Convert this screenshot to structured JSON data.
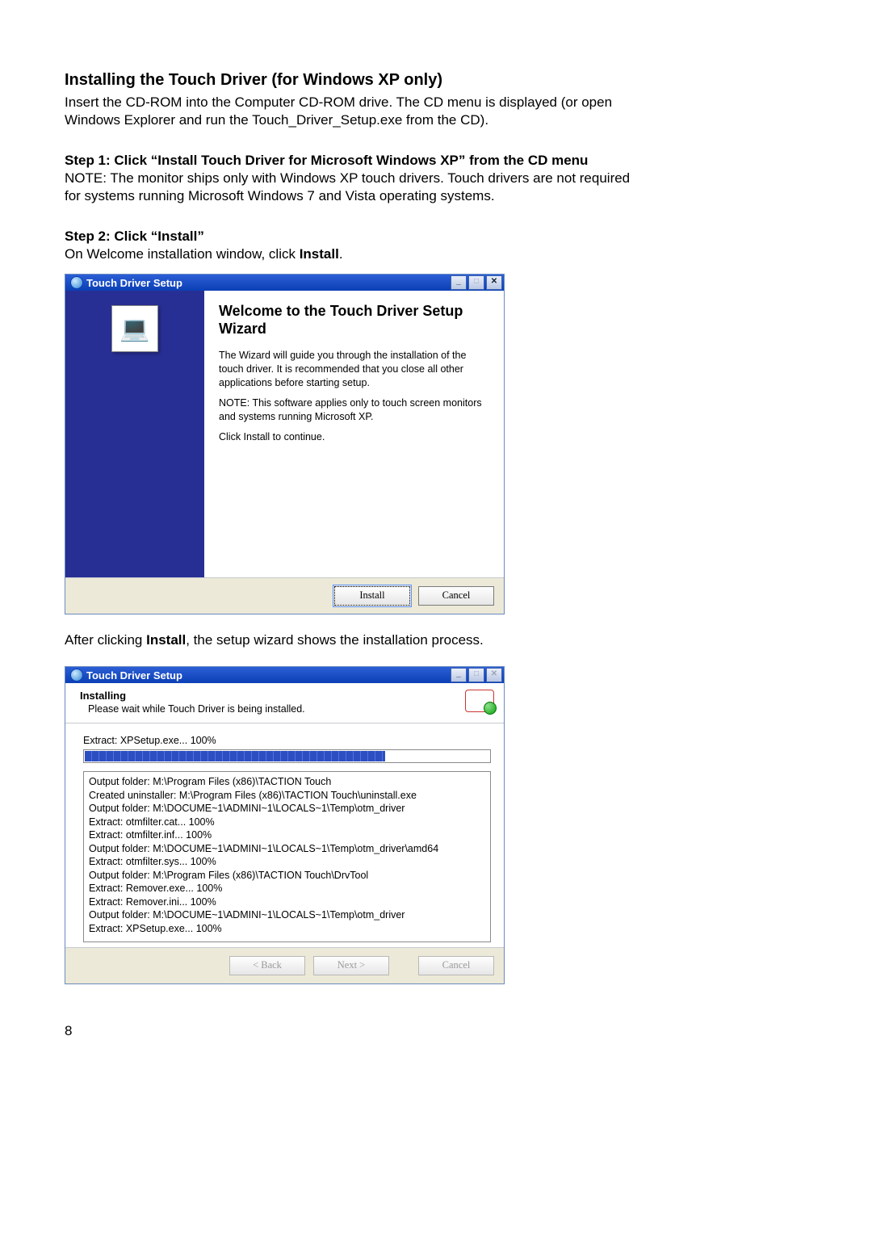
{
  "heading": "Installing the Touch Driver (for Windows XP only)",
  "intro_line1": "Insert the CD-ROM into the Computer CD-ROM drive. The CD menu is displayed (or open",
  "intro_line2": "Windows Explorer and run the Touch_Driver_Setup.exe from the CD).",
  "step1_title": "Step 1: Click “Install Touch Driver for Microsoft Windows XP” from the CD menu",
  "step1_note1": "NOTE: The monitor ships only with Windows XP touch drivers.  Touch drivers are not required",
  "step1_note2": "for systems running Microsoft Windows 7 and Vista operating systems.",
  "step2_title": "Step 2: Click “Install”",
  "step2_text_a": "On Welcome installation window, click ",
  "step2_text_b": "Install",
  "step2_text_c": ".",
  "after_a": "After clicking ",
  "after_b": "Install",
  "after_c": ", the setup wizard shows the installation process.",
  "page_number": "8",
  "win1": {
    "title": "Touch Driver Setup",
    "btn_min": "_",
    "btn_max": "□",
    "btn_close": "✕",
    "heading": "Welcome to the Touch Driver Setup Wizard",
    "para1": "The Wizard will guide you through the installation of the touch driver. It is recommended that you close all other applications before starting setup.",
    "para2": "NOTE: This software applies only to touch screen monitors and systems running Microsoft XP.",
    "para3": "Click Install to continue.",
    "install": "Install",
    "cancel": "Cancel"
  },
  "win2": {
    "title": "Touch Driver Setup",
    "btn_min": "_",
    "btn_max": "□",
    "btn_close": "✕",
    "installing": "Installing",
    "installing_sub": "Please wait while Touch Driver is being installed.",
    "extract_line": "Extract: XPSetup.exe... 100%",
    "log": [
      "Output folder: M:\\Program Files (x86)\\TACTION Touch",
      "Created uninstaller: M:\\Program Files (x86)\\TACTION Touch\\uninstall.exe",
      "Output folder: M:\\DOCUME~1\\ADMINI~1\\LOCALS~1\\Temp\\otm_driver",
      "Extract: otmfilter.cat... 100%",
      "Extract: otmfilter.inf... 100%",
      "Output folder: M:\\DOCUME~1\\ADMINI~1\\LOCALS~1\\Temp\\otm_driver\\amd64",
      "Extract: otmfilter.sys... 100%",
      "Output folder: M:\\Program Files (x86)\\TACTION Touch\\DrvTool",
      "Extract: Remover.exe... 100%",
      "Extract: Remover.ini... 100%",
      "Output folder: M:\\DOCUME~1\\ADMINI~1\\LOCALS~1\\Temp\\otm_driver",
      "Extract: XPSetup.exe... 100%"
    ],
    "back": "< Back",
    "next": "Next >",
    "cancel": "Cancel"
  }
}
